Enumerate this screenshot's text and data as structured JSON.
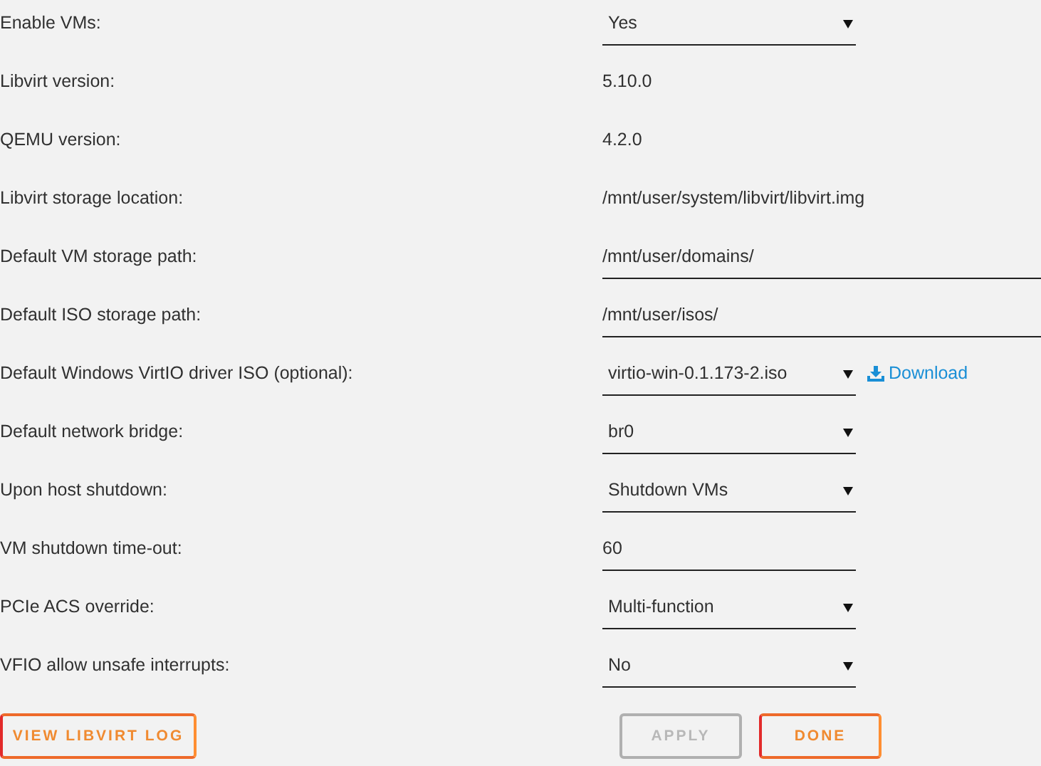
{
  "settings": [
    {
      "label": "Enable VMs:",
      "kind": "select",
      "value": "Yes"
    },
    {
      "label": "Libvirt version:",
      "kind": "text",
      "value": "5.10.0"
    },
    {
      "label": "QEMU version:",
      "kind": "text",
      "value": "4.2.0"
    },
    {
      "label": "Libvirt storage location:",
      "kind": "text",
      "value": "/mnt/user/system/libvirt/libvirt.img"
    },
    {
      "label": "Default VM storage path:",
      "kind": "input",
      "wide": true,
      "value": "/mnt/user/domains/"
    },
    {
      "label": "Default ISO storage path:",
      "kind": "input",
      "wide": true,
      "value": "/mnt/user/isos/"
    },
    {
      "label": "Default Windows VirtIO driver ISO (optional):",
      "kind": "select",
      "value": "virtio-win-0.1.173-2.iso",
      "link": "Download"
    },
    {
      "label": "Default network bridge:",
      "kind": "select",
      "value": "br0"
    },
    {
      "label": "Upon host shutdown:",
      "kind": "select",
      "value": "Shutdown VMs"
    },
    {
      "label": "VM shutdown time-out:",
      "kind": "input",
      "wide": false,
      "value": "60"
    },
    {
      "label": "PCIe ACS override:",
      "kind": "select",
      "value": "Multi-function"
    },
    {
      "label": "VFIO allow unsafe interrupts:",
      "kind": "select",
      "value": "No"
    }
  ],
  "buttons": [
    {
      "label": "VIEW LIBVIRT LOG",
      "disabled": false
    },
    {
      "label": "APPLY",
      "disabled": true
    },
    {
      "label": "DONE",
      "disabled": false
    }
  ]
}
